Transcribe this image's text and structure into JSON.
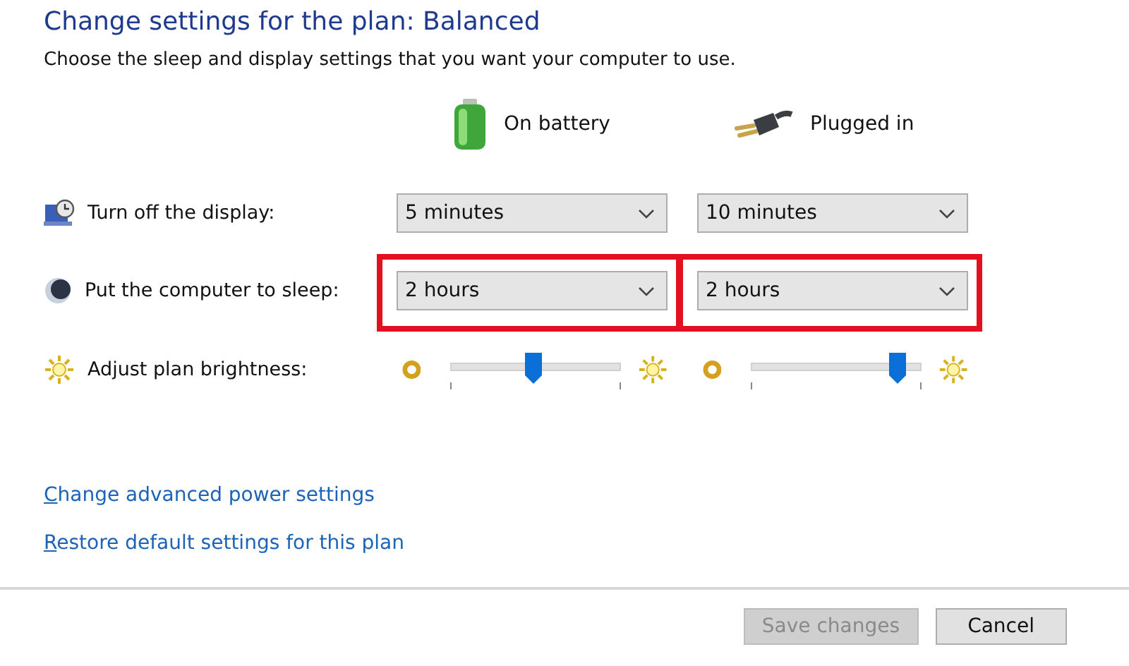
{
  "title": "Change settings for the plan: Balanced",
  "subtitle": "Choose the sleep and display settings that you want your computer to use.",
  "columns": [
    {
      "kind": "battery",
      "label": "On battery"
    },
    {
      "kind": "plug",
      "label": "Plugged in"
    }
  ],
  "settings": [
    {
      "kind": "dropdown",
      "label": "Turn off the display:",
      "values": [
        {
          "value": "5 minutes",
          "highlighted": false
        },
        {
          "value": "10 minutes",
          "highlighted": false
        }
      ]
    },
    {
      "kind": "dropdown",
      "label": "Put the computer to sleep:",
      "values": [
        {
          "value": "2 hours",
          "highlighted": true
        },
        {
          "value": "2 hours",
          "highlighted": true
        }
      ]
    },
    {
      "kind": "slider",
      "label": "Adjust plan brightness:",
      "levels": [
        {
          "level": 0.49
        },
        {
          "level": 0.86
        }
      ]
    }
  ],
  "links": [
    "Change advanced power settings",
    "Restore default settings for this plan"
  ],
  "buttons": [
    {
      "label": "Save changes",
      "disabled": true
    },
    {
      "label": "Cancel",
      "disabled": false
    }
  ]
}
